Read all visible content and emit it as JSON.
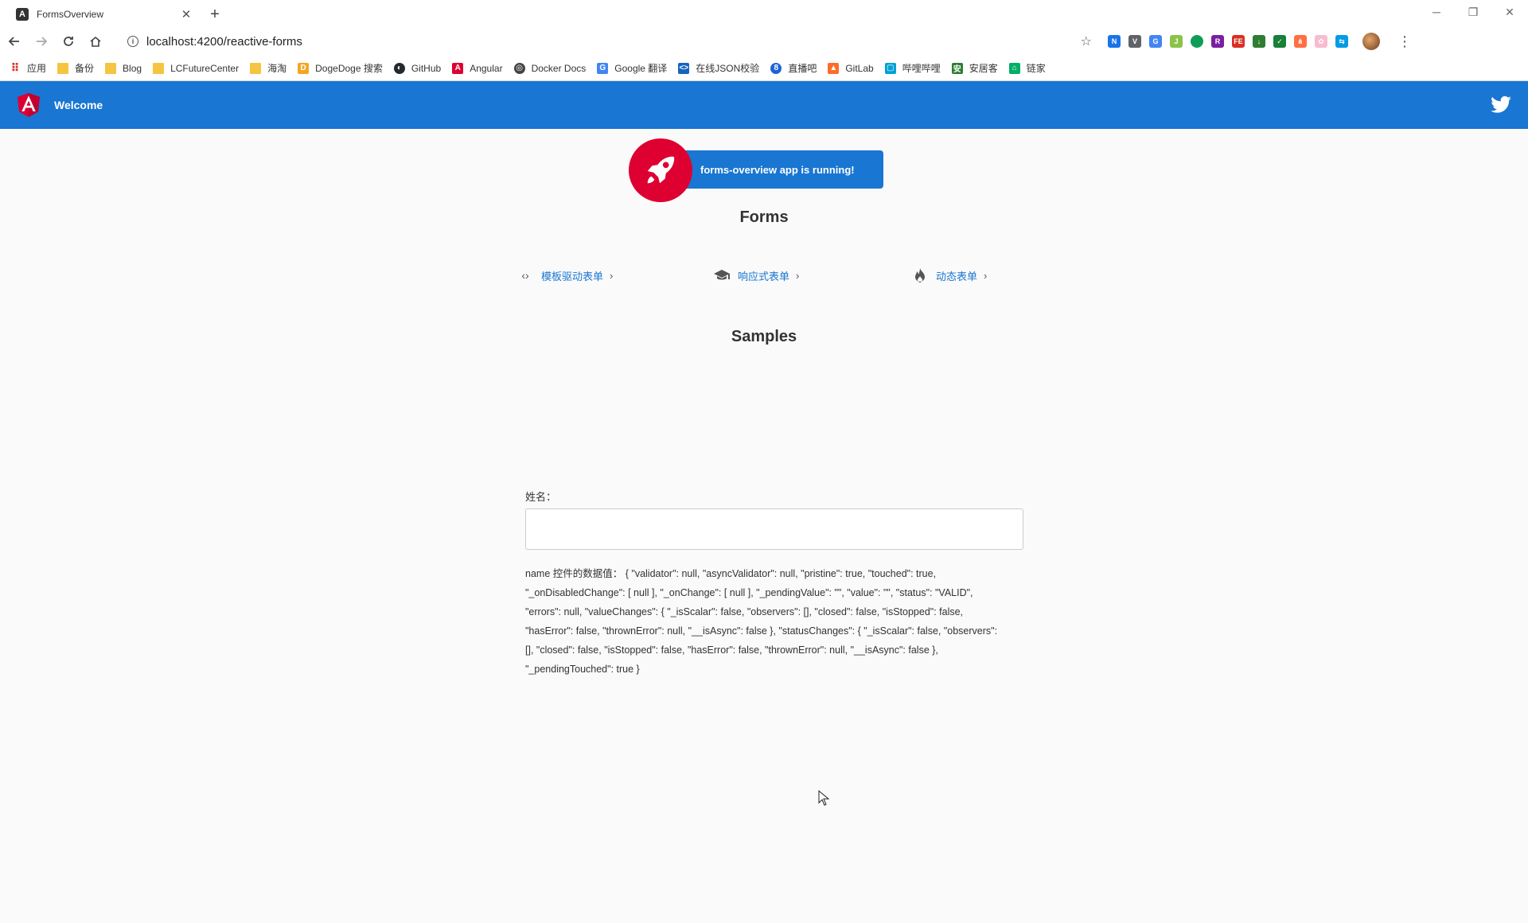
{
  "browser": {
    "tab": {
      "title": "FormsOverview",
      "close_glyph": "✕"
    },
    "new_tab_glyph": "+",
    "window_controls": [
      "─",
      "❐",
      "✕"
    ],
    "url": "localhost:4200/reactive-forms",
    "bookmarks": [
      {
        "label": "应用",
        "icon": "apps-grid-icon"
      },
      {
        "label": "备份",
        "icon": "folder-icon"
      },
      {
        "label": "Blog",
        "icon": "folder-icon"
      },
      {
        "label": "LCFutureCenter",
        "icon": "folder-icon"
      },
      {
        "label": "海淘",
        "icon": "folder-icon"
      },
      {
        "label": "DogeDoge 搜索",
        "icon": "dogedoge-icon"
      },
      {
        "label": "GitHub",
        "icon": "github-icon"
      },
      {
        "label": "Angular",
        "icon": "angular-icon"
      },
      {
        "label": "Docker Docs",
        "icon": "docker-icon"
      },
      {
        "label": "Google 翻译",
        "icon": "google-translate-icon"
      },
      {
        "label": "在线JSON校验",
        "icon": "json-icon"
      },
      {
        "label": "直播吧",
        "icon": "zhibo8-icon"
      },
      {
        "label": "GitLab",
        "icon": "gitlab-icon"
      },
      {
        "label": "哔哩哔哩",
        "icon": "bilibili-icon"
      },
      {
        "label": "安居客",
        "icon": "anjuke-icon"
      },
      {
        "label": "链家",
        "icon": "lianjia-icon"
      }
    ],
    "colors": {
      "accent_red": "#dd0031",
      "folder": "#f5c542"
    }
  },
  "header": {
    "welcome": "Welcome",
    "color": "#1976d2"
  },
  "main": {
    "running_text": "forms-overview app is running!",
    "forms_heading": "Forms",
    "links": [
      {
        "label": "模板驱动表单",
        "icon": "code-brackets-icon"
      },
      {
        "label": "响应式表单",
        "icon": "graduation-cap-icon"
      },
      {
        "label": "动态表单",
        "icon": "flame-icon"
      }
    ],
    "samples_heading": "Samples",
    "form": {
      "label": "姓名：",
      "value": "",
      "json_prefix": "name 控件的数据值：",
      "json_text": "{ \"validator\": null, \"asyncValidator\": null, \"pristine\": true, \"touched\": true, \"_onDisabledChange\": [ null ], \"_onChange\": [ null ], \"_pendingValue\": \"\", \"value\": \"\", \"status\": \"VALID\", \"errors\": null, \"valueChanges\": { \"_isScalar\": false, \"observers\": [], \"closed\": false, \"isStopped\": false, \"hasError\": false, \"thrownError\": null, \"__isAsync\": false }, \"statusChanges\": { \"_isScalar\": false, \"observers\": [], \"closed\": false, \"isStopped\": false, \"hasError\": false, \"thrownError\": null, \"__isAsync\": false }, \"_pendingTouched\": true }"
    }
  }
}
